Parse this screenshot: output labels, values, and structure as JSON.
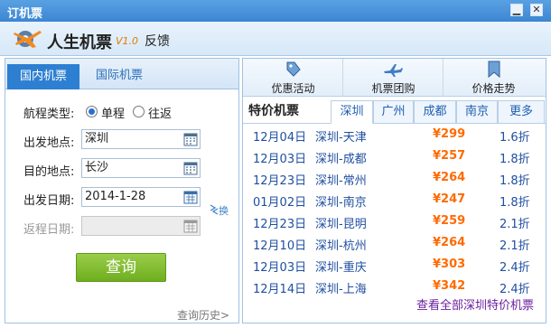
{
  "window": {
    "title": "订机票",
    "min_glyph": "▁",
    "close_glyph": "✕"
  },
  "header": {
    "app_name": "人生机票",
    "version": "V1.0",
    "feedback": "反馈"
  },
  "search": {
    "tabs": [
      {
        "label": "国内机票",
        "active": true
      },
      {
        "label": "国际机票",
        "active": false
      }
    ],
    "trip_type_label": "航程类型:",
    "trip_options": [
      {
        "label": "单程",
        "checked": true
      },
      {
        "label": "往返",
        "checked": false
      }
    ],
    "depart_label": "出发地点:",
    "depart_value": "深圳",
    "dest_label": "目的地点:",
    "dest_value": "长沙",
    "date_label": "出发日期:",
    "date_value": "2014-1-28",
    "return_label": "返程日期:",
    "return_value": "",
    "swap_label": "换",
    "query_button": "查询",
    "history_link": "查询历史>"
  },
  "tools": [
    {
      "label": "优惠活动",
      "icon": "tag-icon"
    },
    {
      "label": "机票团购",
      "icon": "airplane-icon"
    },
    {
      "label": "价格走势",
      "icon": "bookmark-icon"
    }
  ],
  "deals": {
    "title": "特价机票",
    "city_tabs": [
      "深圳",
      "广州",
      "成都",
      "南京",
      "更多"
    ],
    "active_city": "深圳",
    "rows": [
      {
        "date": "12月04日",
        "route": "深圳-天津",
        "price": "¥299",
        "discount": "1.6折"
      },
      {
        "date": "12月03日",
        "route": "深圳-成都",
        "price": "¥257",
        "discount": "1.8折"
      },
      {
        "date": "12月23日",
        "route": "深圳-常州",
        "price": "¥264",
        "discount": "1.8折"
      },
      {
        "date": "01月02日",
        "route": "深圳-南京",
        "price": "¥247",
        "discount": "1.8折"
      },
      {
        "date": "12月23日",
        "route": "深圳-昆明",
        "price": "¥259",
        "discount": "2.1折"
      },
      {
        "date": "12月10日",
        "route": "深圳-杭州",
        "price": "¥264",
        "discount": "2.1折"
      },
      {
        "date": "12月03日",
        "route": "深圳-重庆",
        "price": "¥303",
        "discount": "2.4折"
      },
      {
        "date": "12月14日",
        "route": "深圳-上海",
        "price": "¥342",
        "discount": "2.4折"
      }
    ],
    "view_all": "查看全部深圳特价机票"
  },
  "colors": {
    "accent": "#2d7fd1",
    "price": "#ff6a00",
    "link": "#1f4fa0",
    "query_button": "#7fb834"
  }
}
